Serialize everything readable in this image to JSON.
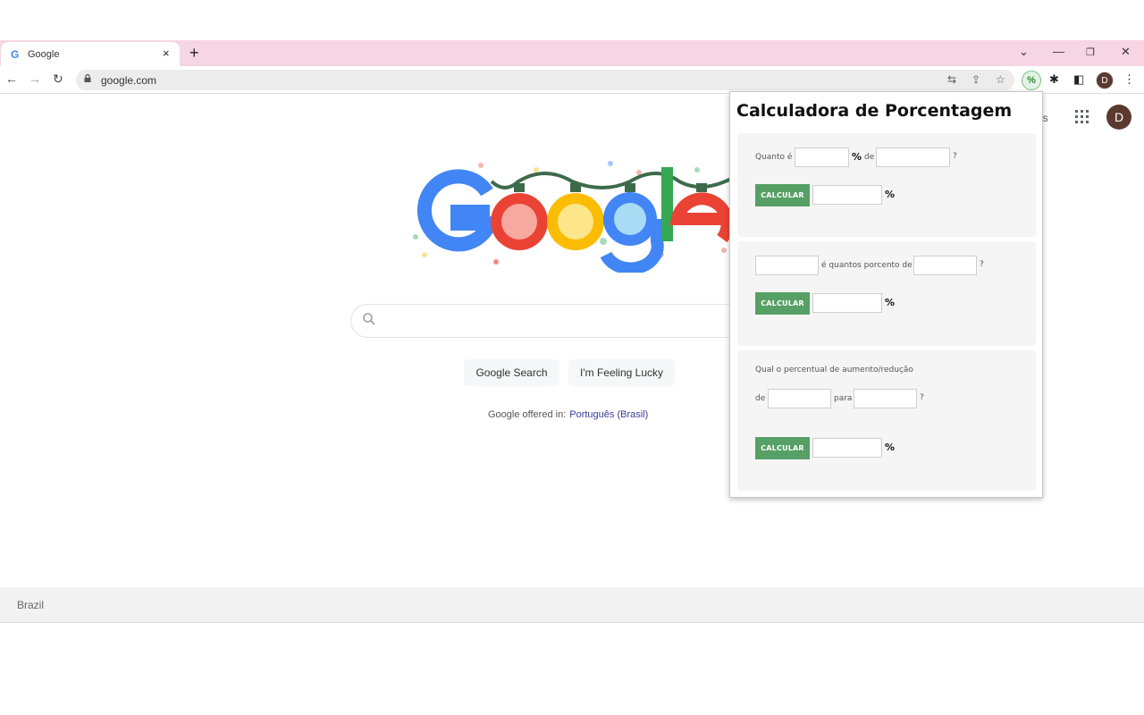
{
  "browser": {
    "tab_title": "Google",
    "tab_favicon": "G",
    "tab_close": "×",
    "new_tab": "+",
    "window_controls": [
      "⌄",
      "—",
      "❐",
      "✕"
    ],
    "url": "google.com",
    "extension_label": "%",
    "profile_initial": "D"
  },
  "google": {
    "partial_header_text": "es",
    "avatar_initial": "D",
    "search_button": "Google Search",
    "lucky_button": "I'm Feeling Lucky",
    "offered_in": "Google offered in:",
    "language_link": "Português (Brasil)",
    "footer_country": "Brazil",
    "doodle_letters": [
      "G",
      "o",
      "o",
      "g",
      "l",
      "e"
    ],
    "colors": {
      "blue": "#4285f4",
      "red": "#ea4335",
      "yellow": "#fbbc05",
      "green": "#34a853"
    }
  },
  "popup": {
    "title": "Calculadora de Porcentagem",
    "accent_color": "#56a065",
    "calc1": {
      "prefix": "Quanto é",
      "pct_symbol": "%",
      "middle": "de",
      "suffix": "?",
      "button": "CALCULAR",
      "result_symbol": "%"
    },
    "calc2": {
      "middle": "é quantos porcento de",
      "suffix": "?",
      "button": "CALCULAR",
      "result_symbol": "%"
    },
    "calc3": {
      "question": "Qual o percentual de aumento/redução",
      "from_label": "de",
      "to_label": "para",
      "suffix": "?",
      "button": "CALCULAR",
      "result_symbol": "%"
    }
  }
}
